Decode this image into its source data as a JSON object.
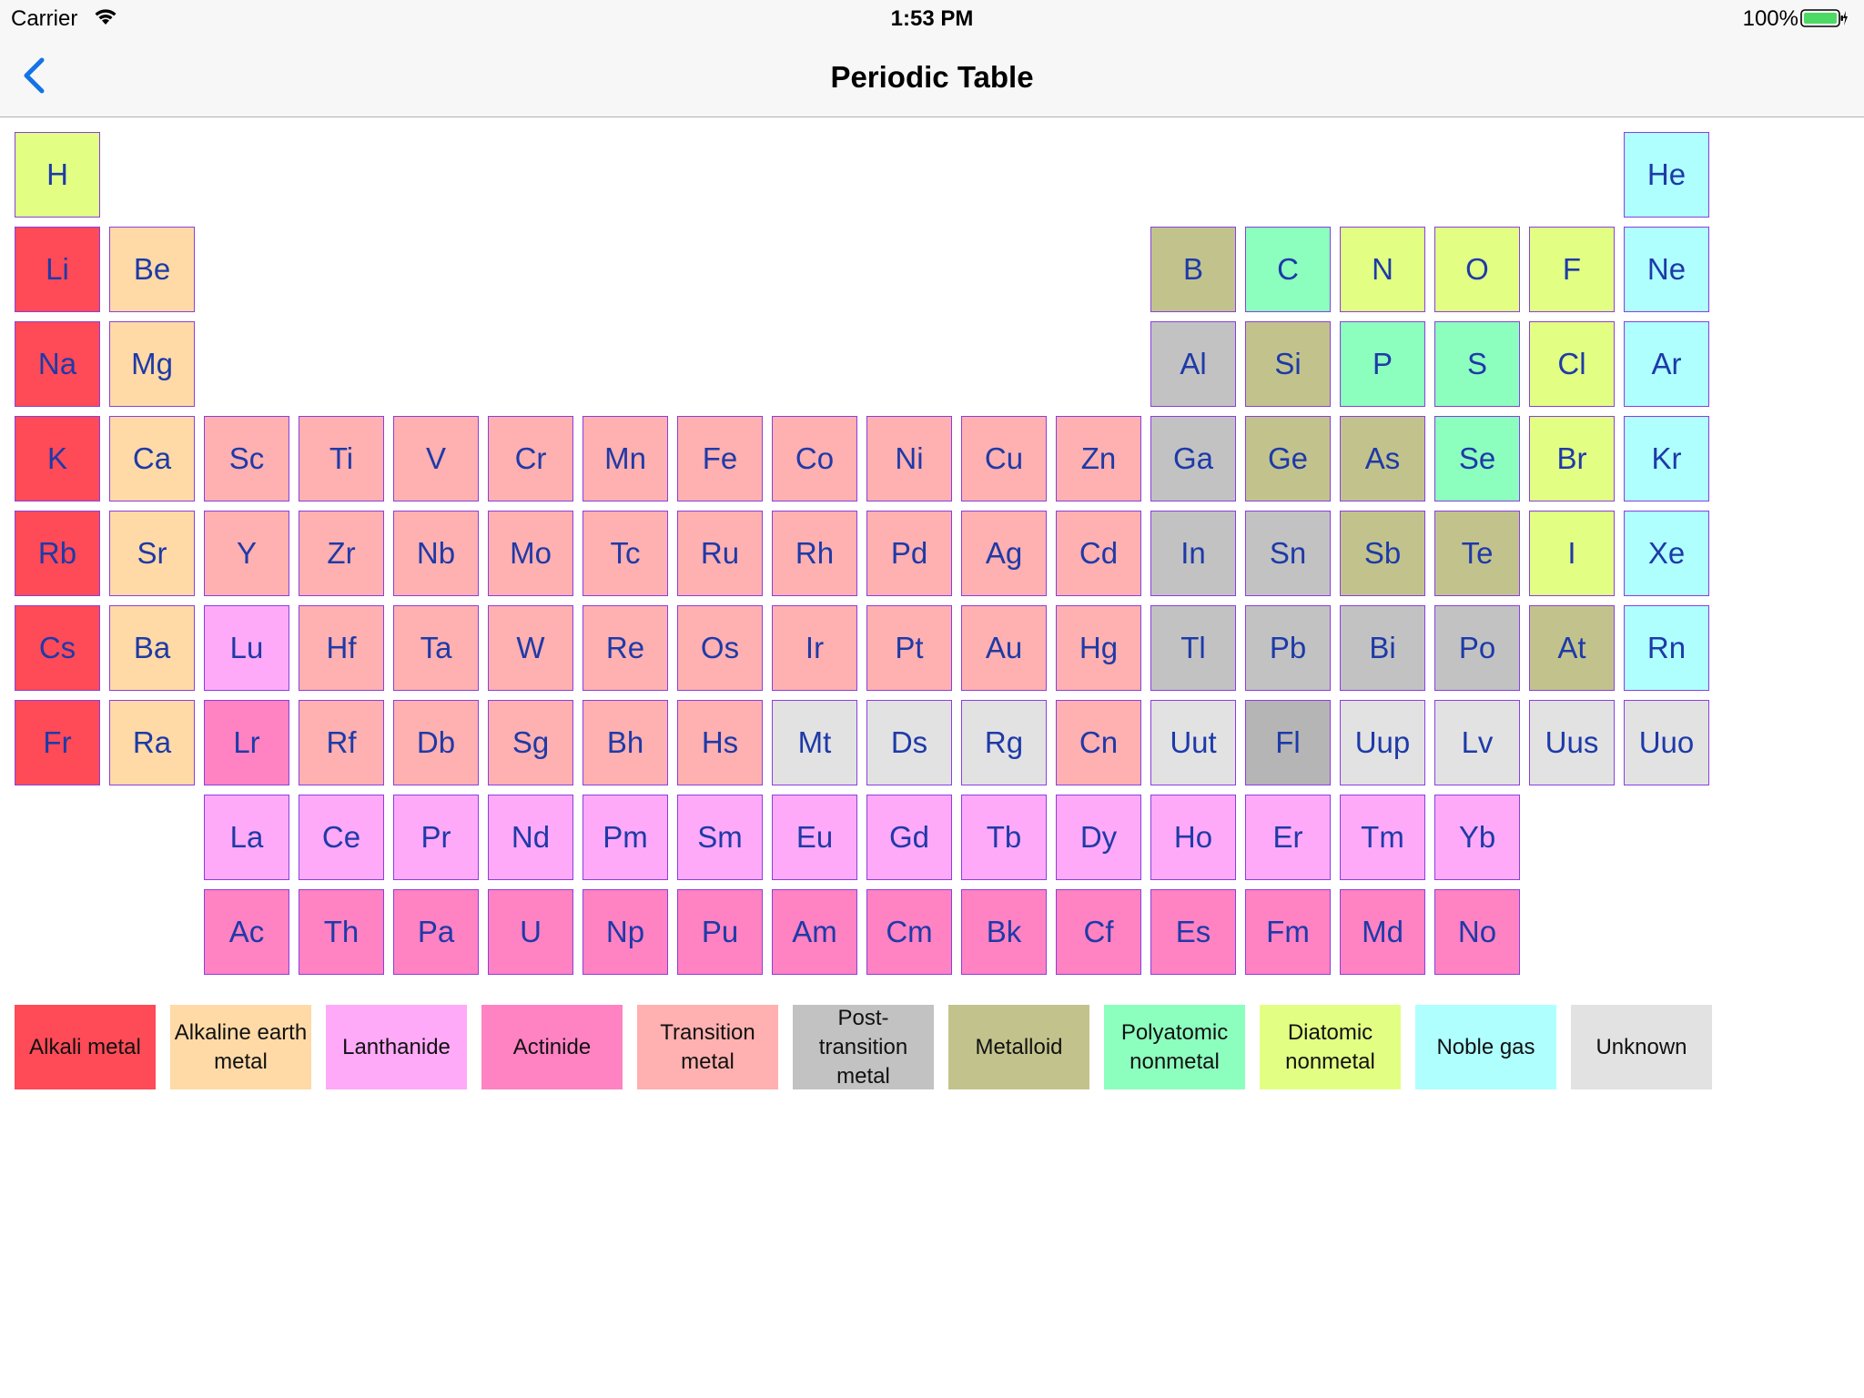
{
  "status_bar": {
    "carrier": "Carrier",
    "time": "1:53 PM",
    "battery_pct": "100%"
  },
  "nav": {
    "title": "Periodic Table",
    "back_icon": "chevron-left-icon"
  },
  "colors": {
    "alkali": "#ff4a57",
    "alkaline": "#ffdaa6",
    "lanthanide": "#ffaaf9",
    "actinide": "#ff82c2",
    "transition": "#ffb0b0",
    "post": "#c2c2c2",
    "metalloid": "#c2c38c",
    "poly": "#8cffbe",
    "diatomic": "#e2ff83",
    "noble": "#afffff",
    "unknown": "#e2e2e2",
    "fl": "#b5b5b5"
  },
  "elements": [
    {
      "s": "H",
      "r": 1,
      "c": 1,
      "k": "diatomic"
    },
    {
      "s": "He",
      "r": 1,
      "c": 18,
      "k": "noble"
    },
    {
      "s": "Li",
      "r": 2,
      "c": 1,
      "k": "alkali"
    },
    {
      "s": "Be",
      "r": 2,
      "c": 2,
      "k": "alkaline"
    },
    {
      "s": "B",
      "r": 2,
      "c": 13,
      "k": "metalloid"
    },
    {
      "s": "C",
      "r": 2,
      "c": 14,
      "k": "poly"
    },
    {
      "s": "N",
      "r": 2,
      "c": 15,
      "k": "diatomic"
    },
    {
      "s": "O",
      "r": 2,
      "c": 16,
      "k": "diatomic"
    },
    {
      "s": "F",
      "r": 2,
      "c": 17,
      "k": "diatomic"
    },
    {
      "s": "Ne",
      "r": 2,
      "c": 18,
      "k": "noble"
    },
    {
      "s": "Na",
      "r": 3,
      "c": 1,
      "k": "alkali"
    },
    {
      "s": "Mg",
      "r": 3,
      "c": 2,
      "k": "alkaline"
    },
    {
      "s": "Al",
      "r": 3,
      "c": 13,
      "k": "post"
    },
    {
      "s": "Si",
      "r": 3,
      "c": 14,
      "k": "metalloid"
    },
    {
      "s": "P",
      "r": 3,
      "c": 15,
      "k": "poly"
    },
    {
      "s": "S",
      "r": 3,
      "c": 16,
      "k": "poly"
    },
    {
      "s": "Cl",
      "r": 3,
      "c": 17,
      "k": "diatomic"
    },
    {
      "s": "Ar",
      "r": 3,
      "c": 18,
      "k": "noble"
    },
    {
      "s": "K",
      "r": 4,
      "c": 1,
      "k": "alkali"
    },
    {
      "s": "Ca",
      "r": 4,
      "c": 2,
      "k": "alkaline"
    },
    {
      "s": "Sc",
      "r": 4,
      "c": 3,
      "k": "transition"
    },
    {
      "s": "Ti",
      "r": 4,
      "c": 4,
      "k": "transition"
    },
    {
      "s": "V",
      "r": 4,
      "c": 5,
      "k": "transition"
    },
    {
      "s": "Cr",
      "r": 4,
      "c": 6,
      "k": "transition"
    },
    {
      "s": "Mn",
      "r": 4,
      "c": 7,
      "k": "transition"
    },
    {
      "s": "Fe",
      "r": 4,
      "c": 8,
      "k": "transition"
    },
    {
      "s": "Co",
      "r": 4,
      "c": 9,
      "k": "transition"
    },
    {
      "s": "Ni",
      "r": 4,
      "c": 10,
      "k": "transition"
    },
    {
      "s": "Cu",
      "r": 4,
      "c": 11,
      "k": "transition"
    },
    {
      "s": "Zn",
      "r": 4,
      "c": 12,
      "k": "transition"
    },
    {
      "s": "Ga",
      "r": 4,
      "c": 13,
      "k": "post"
    },
    {
      "s": "Ge",
      "r": 4,
      "c": 14,
      "k": "metalloid"
    },
    {
      "s": "As",
      "r": 4,
      "c": 15,
      "k": "metalloid"
    },
    {
      "s": "Se",
      "r": 4,
      "c": 16,
      "k": "poly"
    },
    {
      "s": "Br",
      "r": 4,
      "c": 17,
      "k": "diatomic"
    },
    {
      "s": "Kr",
      "r": 4,
      "c": 18,
      "k": "noble"
    },
    {
      "s": "Rb",
      "r": 5,
      "c": 1,
      "k": "alkali"
    },
    {
      "s": "Sr",
      "r": 5,
      "c": 2,
      "k": "alkaline"
    },
    {
      "s": "Y",
      "r": 5,
      "c": 3,
      "k": "transition"
    },
    {
      "s": "Zr",
      "r": 5,
      "c": 4,
      "k": "transition"
    },
    {
      "s": "Nb",
      "r": 5,
      "c": 5,
      "k": "transition"
    },
    {
      "s": "Mo",
      "r": 5,
      "c": 6,
      "k": "transition"
    },
    {
      "s": "Tc",
      "r": 5,
      "c": 7,
      "k": "transition"
    },
    {
      "s": "Ru",
      "r": 5,
      "c": 8,
      "k": "transition"
    },
    {
      "s": "Rh",
      "r": 5,
      "c": 9,
      "k": "transition"
    },
    {
      "s": "Pd",
      "r": 5,
      "c": 10,
      "k": "transition"
    },
    {
      "s": "Ag",
      "r": 5,
      "c": 11,
      "k": "transition"
    },
    {
      "s": "Cd",
      "r": 5,
      "c": 12,
      "k": "transition"
    },
    {
      "s": "In",
      "r": 5,
      "c": 13,
      "k": "post"
    },
    {
      "s": "Sn",
      "r": 5,
      "c": 14,
      "k": "post"
    },
    {
      "s": "Sb",
      "r": 5,
      "c": 15,
      "k": "metalloid"
    },
    {
      "s": "Te",
      "r": 5,
      "c": 16,
      "k": "metalloid"
    },
    {
      "s": "I",
      "r": 5,
      "c": 17,
      "k": "diatomic"
    },
    {
      "s": "Xe",
      "r": 5,
      "c": 18,
      "k": "noble"
    },
    {
      "s": "Cs",
      "r": 6,
      "c": 1,
      "k": "alkali"
    },
    {
      "s": "Ba",
      "r": 6,
      "c": 2,
      "k": "alkaline"
    },
    {
      "s": "Lu",
      "r": 6,
      "c": 3,
      "k": "lanthanide"
    },
    {
      "s": "Hf",
      "r": 6,
      "c": 4,
      "k": "transition"
    },
    {
      "s": "Ta",
      "r": 6,
      "c": 5,
      "k": "transition"
    },
    {
      "s": "W",
      "r": 6,
      "c": 6,
      "k": "transition"
    },
    {
      "s": "Re",
      "r": 6,
      "c": 7,
      "k": "transition"
    },
    {
      "s": "Os",
      "r": 6,
      "c": 8,
      "k": "transition"
    },
    {
      "s": "Ir",
      "r": 6,
      "c": 9,
      "k": "transition"
    },
    {
      "s": "Pt",
      "r": 6,
      "c": 10,
      "k": "transition"
    },
    {
      "s": "Au",
      "r": 6,
      "c": 11,
      "k": "transition"
    },
    {
      "s": "Hg",
      "r": 6,
      "c": 12,
      "k": "transition"
    },
    {
      "s": "Tl",
      "r": 6,
      "c": 13,
      "k": "post"
    },
    {
      "s": "Pb",
      "r": 6,
      "c": 14,
      "k": "post"
    },
    {
      "s": "Bi",
      "r": 6,
      "c": 15,
      "k": "post"
    },
    {
      "s": "Po",
      "r": 6,
      "c": 16,
      "k": "post"
    },
    {
      "s": "At",
      "r": 6,
      "c": 17,
      "k": "metalloid"
    },
    {
      "s": "Rn",
      "r": 6,
      "c": 18,
      "k": "noble"
    },
    {
      "s": "Fr",
      "r": 7,
      "c": 1,
      "k": "alkali"
    },
    {
      "s": "Ra",
      "r": 7,
      "c": 2,
      "k": "alkaline"
    },
    {
      "s": "Lr",
      "r": 7,
      "c": 3,
      "k": "actinide"
    },
    {
      "s": "Rf",
      "r": 7,
      "c": 4,
      "k": "transition"
    },
    {
      "s": "Db",
      "r": 7,
      "c": 5,
      "k": "transition"
    },
    {
      "s": "Sg",
      "r": 7,
      "c": 6,
      "k": "transition"
    },
    {
      "s": "Bh",
      "r": 7,
      "c": 7,
      "k": "transition"
    },
    {
      "s": "Hs",
      "r": 7,
      "c": 8,
      "k": "transition"
    },
    {
      "s": "Mt",
      "r": 7,
      "c": 9,
      "k": "unknown"
    },
    {
      "s": "Ds",
      "r": 7,
      "c": 10,
      "k": "unknown"
    },
    {
      "s": "Rg",
      "r": 7,
      "c": 11,
      "k": "unknown"
    },
    {
      "s": "Cn",
      "r": 7,
      "c": 12,
      "k": "transition"
    },
    {
      "s": "Uut",
      "r": 7,
      "c": 13,
      "k": "unknown"
    },
    {
      "s": "Fl",
      "r": 7,
      "c": 14,
      "k": "fl"
    },
    {
      "s": "Uup",
      "r": 7,
      "c": 15,
      "k": "unknown"
    },
    {
      "s": "Lv",
      "r": 7,
      "c": 16,
      "k": "unknown"
    },
    {
      "s": "Uus",
      "r": 7,
      "c": 17,
      "k": "unknown"
    },
    {
      "s": "Uuo",
      "r": 7,
      "c": 18,
      "k": "unknown"
    },
    {
      "s": "La",
      "r": 8,
      "c": 3,
      "k": "lanthanide"
    },
    {
      "s": "Ce",
      "r": 8,
      "c": 4,
      "k": "lanthanide"
    },
    {
      "s": "Pr",
      "r": 8,
      "c": 5,
      "k": "lanthanide"
    },
    {
      "s": "Nd",
      "r": 8,
      "c": 6,
      "k": "lanthanide"
    },
    {
      "s": "Pm",
      "r": 8,
      "c": 7,
      "k": "lanthanide"
    },
    {
      "s": "Sm",
      "r": 8,
      "c": 8,
      "k": "lanthanide"
    },
    {
      "s": "Eu",
      "r": 8,
      "c": 9,
      "k": "lanthanide"
    },
    {
      "s": "Gd",
      "r": 8,
      "c": 10,
      "k": "lanthanide"
    },
    {
      "s": "Tb",
      "r": 8,
      "c": 11,
      "k": "lanthanide"
    },
    {
      "s": "Dy",
      "r": 8,
      "c": 12,
      "k": "lanthanide"
    },
    {
      "s": "Ho",
      "r": 8,
      "c": 13,
      "k": "lanthanide"
    },
    {
      "s": "Er",
      "r": 8,
      "c": 14,
      "k": "lanthanide"
    },
    {
      "s": "Tm",
      "r": 8,
      "c": 15,
      "k": "lanthanide"
    },
    {
      "s": "Yb",
      "r": 8,
      "c": 16,
      "k": "lanthanide"
    },
    {
      "s": "Ac",
      "r": 9,
      "c": 3,
      "k": "actinide"
    },
    {
      "s": "Th",
      "r": 9,
      "c": 4,
      "k": "actinide"
    },
    {
      "s": "Pa",
      "r": 9,
      "c": 5,
      "k": "actinide"
    },
    {
      "s": "U",
      "r": 9,
      "c": 6,
      "k": "actinide"
    },
    {
      "s": "Np",
      "r": 9,
      "c": 7,
      "k": "actinide"
    },
    {
      "s": "Pu",
      "r": 9,
      "c": 8,
      "k": "actinide"
    },
    {
      "s": "Am",
      "r": 9,
      "c": 9,
      "k": "actinide"
    },
    {
      "s": "Cm",
      "r": 9,
      "c": 10,
      "k": "actinide"
    },
    {
      "s": "Bk",
      "r": 9,
      "c": 11,
      "k": "actinide"
    },
    {
      "s": "Cf",
      "r": 9,
      "c": 12,
      "k": "actinide"
    },
    {
      "s": "Es",
      "r": 9,
      "c": 13,
      "k": "actinide"
    },
    {
      "s": "Fm",
      "r": 9,
      "c": 14,
      "k": "actinide"
    },
    {
      "s": "Md",
      "r": 9,
      "c": 15,
      "k": "actinide"
    },
    {
      "s": "No",
      "r": 9,
      "c": 16,
      "k": "actinide"
    }
  ],
  "legend": [
    {
      "label": "Alkali metal",
      "k": "alkali"
    },
    {
      "label": "Alkaline earth metal",
      "k": "alkaline"
    },
    {
      "label": "Lanthanide",
      "k": "lanthanide"
    },
    {
      "label": "Actinide",
      "k": "actinide"
    },
    {
      "label": "Transition metal",
      "k": "transition"
    },
    {
      "label": "Post-transition metal",
      "k": "post"
    },
    {
      "label": "Metalloid",
      "k": "metalloid"
    },
    {
      "label": "Polyatomic nonmetal",
      "k": "poly"
    },
    {
      "label": "Diatomic nonmetal",
      "k": "diatomic"
    },
    {
      "label": "Noble gas",
      "k": "noble"
    },
    {
      "label": "Unknown",
      "k": "unknown"
    }
  ]
}
